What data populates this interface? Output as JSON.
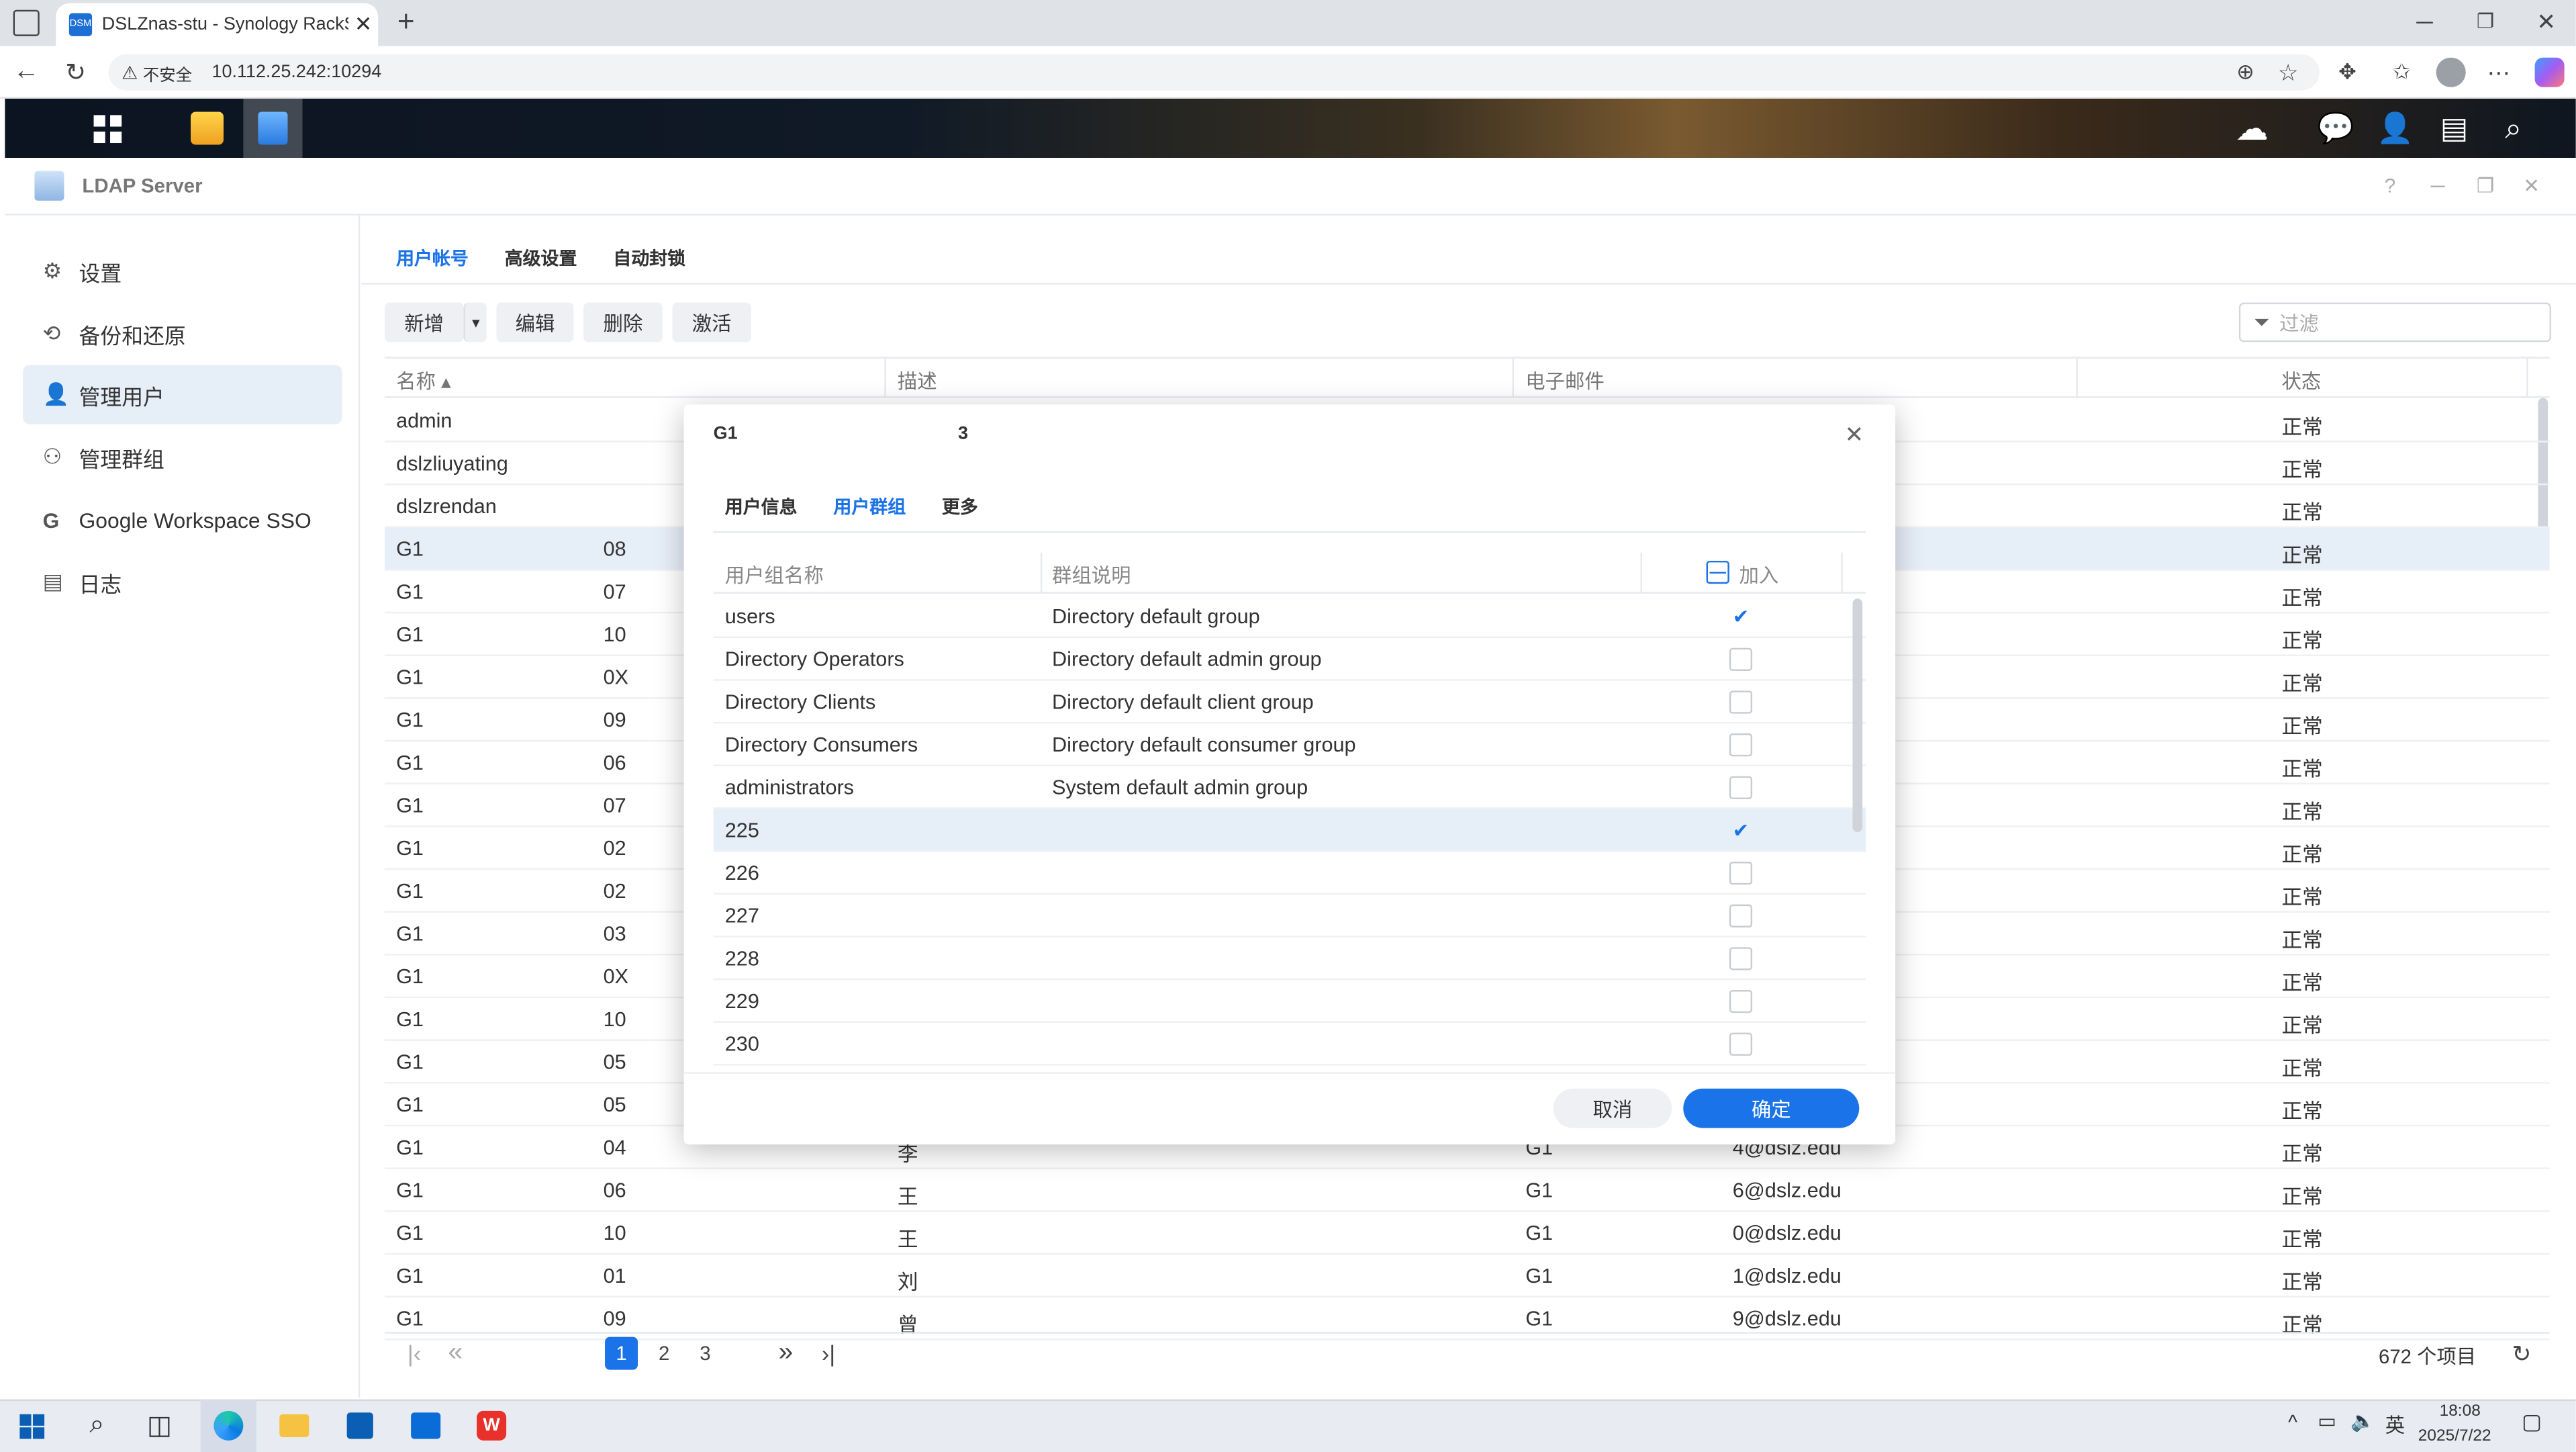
{
  "browser": {
    "tab_title": "DSLZnas-stu - Synology RackStati",
    "favicon_text": "DSM",
    "security_label": "不安全",
    "url": "10.112.25.242:10294",
    "new_tab_symbol": "+"
  },
  "app": {
    "window_title": "LDAP Server",
    "sidebar": [
      {
        "label": "设置",
        "icon": "gear-icon"
      },
      {
        "label": "备份和还原",
        "icon": "restore-icon"
      },
      {
        "label": "管理用户",
        "icon": "user-icon"
      },
      {
        "label": "管理群组",
        "icon": "group-icon"
      },
      {
        "label": "Google Workspace SSO",
        "icon": "google-icon"
      },
      {
        "label": "日志",
        "icon": "log-icon"
      }
    ],
    "tabs": [
      "用户帐号",
      "高级设置",
      "自动封锁"
    ],
    "toolbar": {
      "add": "新增",
      "edit": "编辑",
      "delete": "删除",
      "activate": "激活",
      "filter_placeholder": "过滤"
    },
    "columns": {
      "name": "名称 ▴",
      "desc": "描述",
      "email": "电子邮件",
      "status": "状态"
    },
    "rows": [
      {
        "name": "admin",
        "status": "正常"
      },
      {
        "name": "dslzliuyating",
        "status": "正常"
      },
      {
        "name": "dslzrendan",
        "status": "正常"
      },
      {
        "name": "G1",
        "id": "08",
        "status": "正常"
      },
      {
        "name": "G1",
        "id": "07",
        "status": "正常"
      },
      {
        "name": "G1",
        "id": "10",
        "status": "正常"
      },
      {
        "name": "G1",
        "id": "0X",
        "status": "正常"
      },
      {
        "name": "G1",
        "id": "09",
        "status": "正常"
      },
      {
        "name": "G1",
        "id": "06",
        "status": "正常"
      },
      {
        "name": "G1",
        "id": "07",
        "status": "正常"
      },
      {
        "name": "G1",
        "id": "02",
        "status": "正常"
      },
      {
        "name": "G1",
        "id": "02",
        "status": "正常"
      },
      {
        "name": "G1",
        "id": "03",
        "status": "正常"
      },
      {
        "name": "G1",
        "id": "0X",
        "status": "正常"
      },
      {
        "name": "G1",
        "id": "10",
        "status": "正常"
      },
      {
        "name": "G1",
        "id": "05",
        "status": "正常"
      },
      {
        "name": "G1",
        "id": "05",
        "status": "正常"
      },
      {
        "name": "G1",
        "id": "04",
        "desc": "李",
        "email1": "G1",
        "email2": "4@dslz.edu",
        "status": "正常"
      },
      {
        "name": "G1",
        "id": "06",
        "desc": "王",
        "email1": "G1",
        "email2": "6@dslz.edu",
        "status": "正常"
      },
      {
        "name": "G1",
        "id": "10",
        "desc": "王",
        "email1": "G1",
        "email2": "0@dslz.edu",
        "status": "正常"
      },
      {
        "name": "G1",
        "id": "01",
        "desc": "刘",
        "email1": "G1",
        "email2": "1@dslz.edu",
        "status": "正常"
      },
      {
        "name": "G1",
        "id": "09",
        "desc": "曾",
        "email1": "G1",
        "email2": "9@dslz.edu",
        "status": "正常"
      }
    ],
    "pagination": {
      "pages": [
        "1",
        "2",
        "3"
      ],
      "total": "672 个项目"
    }
  },
  "dialog": {
    "title": "G1",
    "title_suffix": "3",
    "tabs": [
      "用户信息",
      "用户群组",
      "更多"
    ],
    "columns": {
      "group": "用户组名称",
      "desc": "群组说明",
      "join": "加入"
    },
    "groups": [
      {
        "name": "users",
        "desc": "Directory default group",
        "checked": true
      },
      {
        "name": "Directory Operators",
        "desc": "Directory default admin group",
        "checked": false
      },
      {
        "name": "Directory Clients",
        "desc": "Directory default client group",
        "checked": false
      },
      {
        "name": "Directory Consumers",
        "desc": "Directory default consumer group",
        "checked": false
      },
      {
        "name": "administrators",
        "desc": "System default admin group",
        "checked": false
      },
      {
        "name": "225",
        "desc": "",
        "checked": true
      },
      {
        "name": "226",
        "desc": "",
        "checked": false
      },
      {
        "name": "227",
        "desc": "",
        "checked": false
      },
      {
        "name": "228",
        "desc": "",
        "checked": false
      },
      {
        "name": "229",
        "desc": "",
        "checked": false
      },
      {
        "name": "230",
        "desc": "",
        "checked": false
      }
    ],
    "cancel": "取消",
    "ok": "确定"
  },
  "taskbar": {
    "time": "18:08",
    "date": "2025/7/22",
    "ime": "英"
  },
  "colors": {
    "accent": "#1a73e8",
    "select": "#e6eef8",
    "primary_btn": "#1a73e8"
  }
}
